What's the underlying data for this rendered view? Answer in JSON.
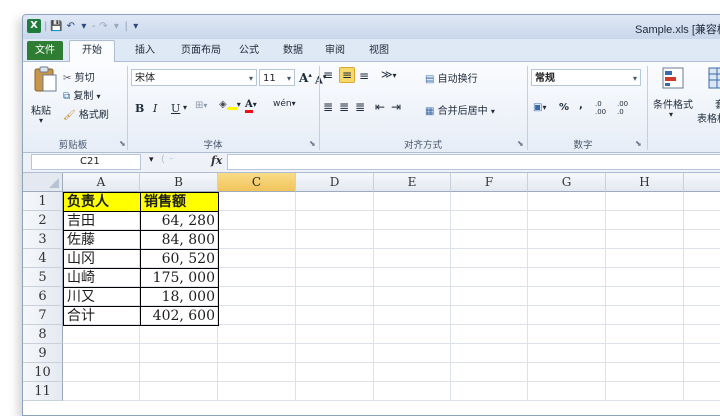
{
  "window": {
    "title": "Sample.xls [兼容模式] - Microsoft Excel",
    "qat": {
      "logo": "X",
      "save": "💾",
      "undo": "↶",
      "undo_drop": "▾",
      "redo": "↷",
      "redo_drop": "▾",
      "customize": "▾"
    }
  },
  "tabs": {
    "file": "文件",
    "items": [
      "开始",
      "插入",
      "页面布局",
      "公式",
      "数据",
      "审阅",
      "视图"
    ]
  },
  "ribbon": {
    "clipboard": {
      "paste": "粘贴",
      "cut": "剪切",
      "copy": "复制",
      "format_painter": "格式刷",
      "label": "剪贴板"
    },
    "font": {
      "name": "宋体",
      "size": "11",
      "grow": "A",
      "shrink": "A",
      "bold": "B",
      "italic": "I",
      "underline": "U",
      "label": "字体",
      "phonetic": "wén"
    },
    "alignment": {
      "wrap": "自动换行",
      "merge": "合并后居中",
      "label": "对齐方式"
    },
    "number": {
      "format": "常规",
      "percent": "%",
      "comma": ",",
      "inc_decimal": ".0 .00",
      "dec_decimal": ".00 .0",
      "label": "数字"
    },
    "styles": {
      "conditional": "条件格式",
      "table_line1": "套用",
      "table_line2": "表格格式"
    }
  },
  "formula_bar": {
    "name_box": "C21",
    "fx": "fx",
    "value": ""
  },
  "grid": {
    "columns": [
      "A",
      "B",
      "C",
      "D",
      "E",
      "F",
      "G",
      "H"
    ],
    "selected_column": "C",
    "rows": [
      "1",
      "2",
      "3",
      "4",
      "5",
      "6",
      "7",
      "8",
      "9",
      "10",
      "11"
    ],
    "table": {
      "header": [
        "负责人",
        "销售额"
      ],
      "rows": [
        [
          "吉田",
          "64, 280"
        ],
        [
          "佐藤",
          "84, 800"
        ],
        [
          "山冈",
          "60, 520"
        ],
        [
          "山崎",
          "175, 000"
        ],
        [
          "川又",
          "18, 000"
        ],
        [
          "合计",
          "402, 600"
        ]
      ]
    }
  },
  "colors": {
    "file_tab": "#2f7d33",
    "header_fill": "#ffff00",
    "selected_header": "#f1c45b"
  }
}
